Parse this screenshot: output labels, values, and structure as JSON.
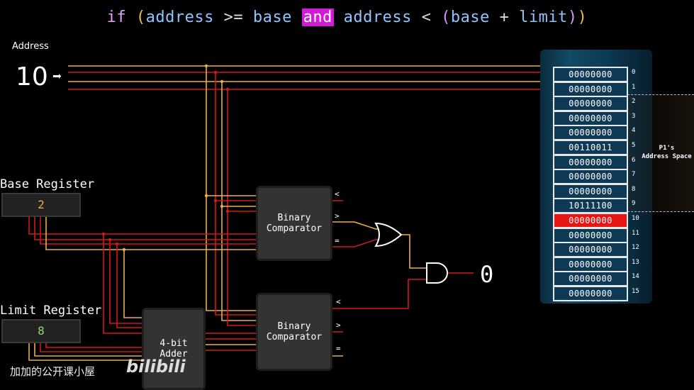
{
  "condition": {
    "kw_if": "if",
    "paren_open": "(",
    "address1": "address",
    "op_ge": ">=",
    "base1": "base",
    "and": "and",
    "address2": "address",
    "op_lt": "<",
    "paren2_open": "(",
    "base2": "base",
    "op_plus": "+",
    "limit": "limit",
    "paren2_close": ")",
    "paren_close": ")"
  },
  "address": {
    "title": "Address",
    "value": "10"
  },
  "base_register": {
    "label": "Base Register",
    "value": "2"
  },
  "limit_register": {
    "label": "Limit Register",
    "value": "8"
  },
  "comparators": [
    {
      "label_line1": "Binary",
      "label_line2": "Comparator",
      "lt": "<",
      "gt": ">",
      "eq": "="
    },
    {
      "label_line1": "Binary",
      "label_line2": "Comparator",
      "lt": "<",
      "gt": ">",
      "eq": "="
    }
  ],
  "adder": {
    "label_line1": "4-bit",
    "label_line2": "Adder"
  },
  "result": "0",
  "memory": {
    "cells": [
      "00000000",
      "00000000",
      "00000000",
      "00000000",
      "00000000",
      "00110011",
      "00000000",
      "00000000",
      "00000000",
      "10111100",
      "00000000",
      "00000000",
      "00000000",
      "00000000",
      "00000000",
      "00000000"
    ],
    "indices": [
      "0",
      "1",
      "2",
      "3",
      "4",
      "5",
      "6",
      "7",
      "8",
      "9",
      "10",
      "11",
      "12",
      "13",
      "14",
      "15"
    ],
    "highlight_index": 10,
    "p1_label_line1": "P1's",
    "p1_label_line2": "Address Space"
  },
  "watermark": {
    "text": "加加的公开课小屋",
    "logo": "bilibili"
  },
  "colors": {
    "wire_yellow": "#e8b04a",
    "wire_red": "#d31818",
    "highlight": "#e81515",
    "and_bg": "#d21bd6"
  }
}
